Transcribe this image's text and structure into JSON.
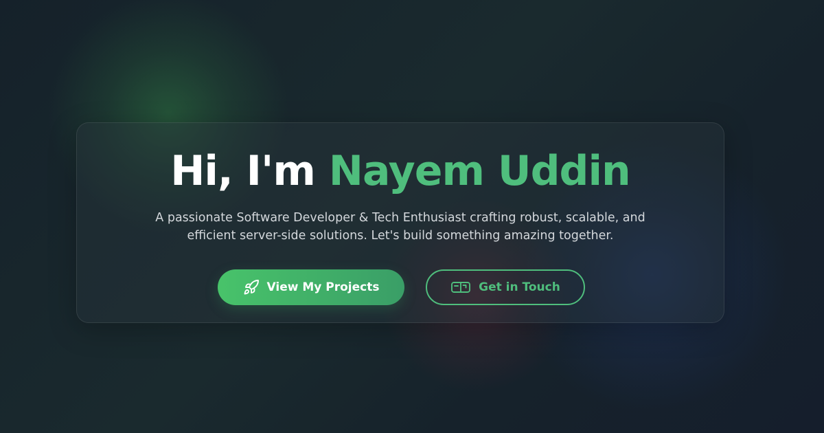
{
  "hero": {
    "greeting": "Hi, I'm",
    "name": "Nayem Uddin",
    "tagline_line1": "A passionate Software Developer & Tech Enthusiast crafting robust, scalable, and",
    "tagline_line2": "efficient server-side solutions. Let's build something amazing together.",
    "primary_button": {
      "label": "View My Projects",
      "icon": "rocket-icon"
    },
    "secondary_button": {
      "label": "Get in Touch",
      "icon": "mailbox-icon"
    }
  },
  "colors": {
    "accent": "#4fbe7d",
    "background": "#17232a",
    "primary_gradient_start": "#48c36a",
    "primary_gradient_end": "#3a9e67",
    "text": "#ffffff",
    "muted_text": "#d4d8dc"
  }
}
